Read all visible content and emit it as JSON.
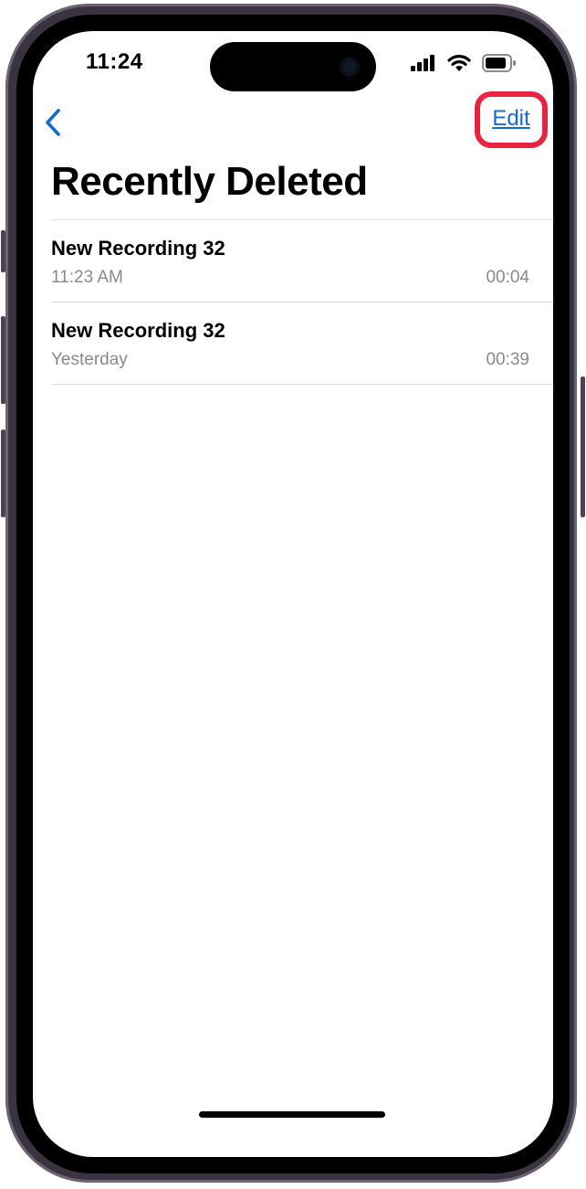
{
  "status_bar": {
    "time": "11:24",
    "icons": [
      "cellular-signal-icon",
      "wifi-icon",
      "battery-icon"
    ]
  },
  "nav": {
    "back_icon": "chevron-left-icon",
    "edit_label": "Edit",
    "highlight_color": "#e8243f"
  },
  "page": {
    "title": "Recently Deleted"
  },
  "recordings": [
    {
      "title": "New Recording 32",
      "date": "11:23 AM",
      "duration": "00:04"
    },
    {
      "title": "New Recording 32",
      "date": "Yesterday",
      "duration": "00:39"
    }
  ],
  "colors": {
    "accent": "#1469d6",
    "secondary_text": "#8a8a8e",
    "separator": "#dcdcdc"
  }
}
